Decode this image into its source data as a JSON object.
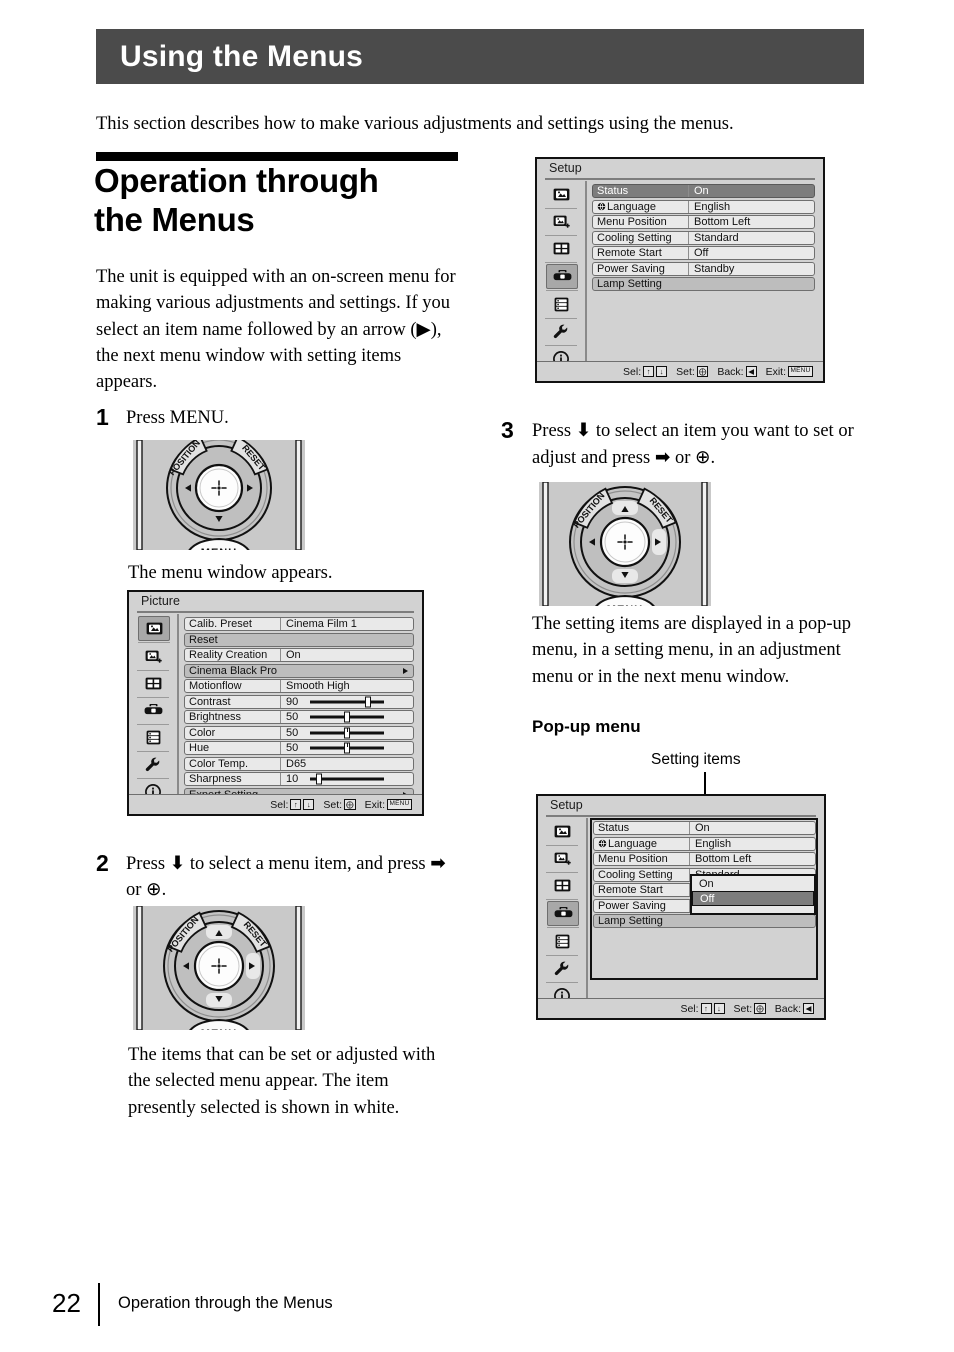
{
  "header": {
    "title": "Using the Menus"
  },
  "intro": "This section describes how to make various adjustments and settings using the menus.",
  "section": {
    "title_line1": "Operation through",
    "title_line2": "the Menus",
    "lead": "The unit is equipped with an on-screen menu for making various adjustments and settings. If you select an item name followed by an arrow (▶), the next menu window with setting items appears."
  },
  "steps": {
    "one": {
      "number": "1",
      "text": "Press MENU.",
      "result": "The menu window appears."
    },
    "two": {
      "number": "2",
      "text_a": "Press ",
      "text_b": " to select a menu item, and press ",
      "text_c": " or ",
      "text_d": ".",
      "result": "The items that can be set or adjusted with the selected menu appear. The item presently selected is shown in white."
    },
    "three": {
      "number": "3",
      "text_a": "Press ",
      "text_b": " to select an item you want to set or adjust and press ",
      "text_c": " or ",
      "text_d": ".",
      "result": "The setting items are displayed in a pop-up menu, in a setting menu, in an adjustment menu or in the next menu window."
    }
  },
  "popup_section": {
    "heading": "Pop-up menu",
    "callout": "Setting items"
  },
  "remote": {
    "position_label": "POSITION",
    "reset_label": "RESET",
    "menu_label": "MENU"
  },
  "osd_setup_top": {
    "title": "Setup",
    "rows": [
      {
        "label": "Status",
        "value": "On",
        "highlight": true
      },
      {
        "label": "Language",
        "value": "English",
        "globe": true
      },
      {
        "label": "Menu Position",
        "value": "Bottom Left"
      },
      {
        "label": "Cooling Setting",
        "value": "Standard"
      },
      {
        "label": "Remote Start",
        "value": "Off"
      },
      {
        "label": "Power Saving",
        "value": "Standby"
      },
      {
        "label": "Lamp Setting",
        "value": "",
        "wide": true
      }
    ],
    "bar": [
      {
        "text": "Sel:",
        "keys": [
          "↑",
          "↓"
        ]
      },
      {
        "text": "Set:",
        "keys": [
          "⨁"
        ]
      },
      {
        "text": "Back:",
        "keys": [
          "◀"
        ]
      },
      {
        "text": "Exit:",
        "keys": [
          "MENU"
        ]
      }
    ],
    "selected_icon_index": 3
  },
  "osd_picture": {
    "title": "Picture",
    "rows": [
      {
        "label": "Calib. Preset",
        "value": "Cinema Film 1"
      },
      {
        "label": "Reset",
        "value": "",
        "wide": true
      },
      {
        "label": "Reality Creation",
        "value": "On"
      },
      {
        "label": "Cinema Black Pro",
        "value": "",
        "wide": true,
        "arrow": true
      },
      {
        "label": "Motionflow",
        "value": "Smooth High"
      },
      {
        "label": "Contrast",
        "value": "90",
        "slider": 0.78
      },
      {
        "label": "Brightness",
        "value": "50",
        "slider": 0.5
      },
      {
        "label": "Color",
        "value": "50",
        "slider": 0.5,
        "tick": true
      },
      {
        "label": "Hue",
        "value": "50",
        "slider": 0.5,
        "tick": true
      },
      {
        "label": "Color Temp.",
        "value": "D65"
      },
      {
        "label": "Sharpness",
        "value": "10",
        "slider": 0.12
      },
      {
        "label": "Expert Setting",
        "value": "",
        "wide": true,
        "arrow": true
      }
    ],
    "bar": [
      {
        "text": "Sel:",
        "keys": [
          "↑",
          "↓"
        ]
      },
      {
        "text": "Set:",
        "keys": [
          "⨁"
        ]
      },
      {
        "text": "Exit:",
        "keys": [
          "MENU"
        ]
      }
    ],
    "selected_icon_index": 0
  },
  "osd_setup_popup": {
    "title": "Setup",
    "rows": [
      {
        "label": "Status",
        "value": "On"
      },
      {
        "label": "Language",
        "value": "English",
        "globe": true
      },
      {
        "label": "Menu Position",
        "value": "Bottom Left"
      },
      {
        "label": "Cooling Setting",
        "value": "Standard"
      },
      {
        "label": "Remote Start",
        "value": "",
        "dim": true
      },
      {
        "label": "Power Saving",
        "value": "",
        "dim": true
      },
      {
        "label": "Lamp Setting",
        "value": "",
        "wide": true
      }
    ],
    "popup_options": [
      {
        "label": "On",
        "selected": false
      },
      {
        "label": "Off",
        "selected": true
      }
    ],
    "bar": [
      {
        "text": "Sel:",
        "keys": [
          "↑",
          "↓"
        ]
      },
      {
        "text": "Set:",
        "keys": [
          "⨁"
        ]
      },
      {
        "text": "Back:",
        "keys": [
          "◀"
        ]
      }
    ],
    "selected_icon_index": 3
  },
  "osd_icon_names": [
    "picture-icon",
    "picture-adjust-icon",
    "screen-icon",
    "setup-toolbox-icon",
    "function-list-icon",
    "installation-wrench-icon",
    "information-icon"
  ],
  "footer": {
    "page_number": "22",
    "label": "Operation through the Menus"
  }
}
